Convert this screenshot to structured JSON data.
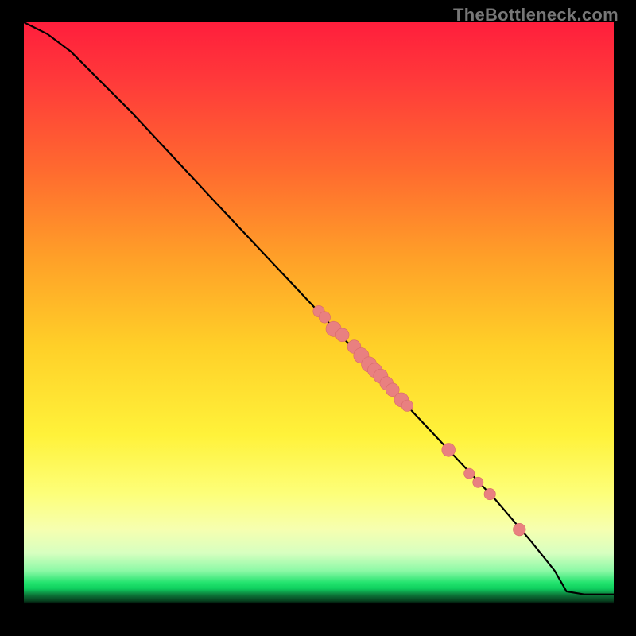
{
  "watermark": "TheBottleneck.com",
  "colors": {
    "curve": "#000000",
    "dot_fill": "#e98080",
    "dot_stroke": "#d86a6a"
  },
  "chart_data": {
    "type": "line",
    "title": "",
    "xlabel": "",
    "ylabel": "",
    "xlim": [
      0,
      100
    ],
    "ylim": [
      0,
      100
    ],
    "grid": false,
    "legend": false,
    "series": [
      {
        "name": "curve",
        "note": "Black curve. Starts at top-left (x≈0, y≈100), gentle shoulder then roughly linear descent to x≈92 where it flattens near y≈3 and runs flat to x=100.",
        "x": [
          0,
          4,
          8,
          12,
          18,
          25,
          32,
          40,
          48,
          56,
          64,
          72,
          80,
          86,
          90,
          92,
          95,
          100
        ],
        "y": [
          100,
          98,
          95,
          91,
          85,
          77.5,
          70,
          61.5,
          53,
          44.5,
          36,
          27.5,
          19,
          12,
          7,
          3.5,
          3,
          3
        ]
      }
    ],
    "points": [
      {
        "name": "cluster-a-1",
        "x": 50,
        "y": 51,
        "r": 1.2
      },
      {
        "name": "cluster-a-2",
        "x": 51,
        "y": 50,
        "r": 1.2
      },
      {
        "name": "cluster-a-3",
        "x": 52.5,
        "y": 48,
        "r": 1.6
      },
      {
        "name": "cluster-a-4",
        "x": 54,
        "y": 47,
        "r": 1.4
      },
      {
        "name": "cluster-b-1",
        "x": 56,
        "y": 45,
        "r": 1.4
      },
      {
        "name": "cluster-b-2",
        "x": 57.2,
        "y": 43.5,
        "r": 1.6
      },
      {
        "name": "cluster-b-3",
        "x": 58.5,
        "y": 42,
        "r": 1.6
      },
      {
        "name": "cluster-b-4",
        "x": 59.5,
        "y": 41,
        "r": 1.5
      },
      {
        "name": "cluster-b-5",
        "x": 60.5,
        "y": 40,
        "r": 1.5
      },
      {
        "name": "cluster-b-6",
        "x": 61.5,
        "y": 38.8,
        "r": 1.4
      },
      {
        "name": "cluster-b-7",
        "x": 62.5,
        "y": 37.7,
        "r": 1.4
      },
      {
        "name": "cluster-b-8",
        "x": 64,
        "y": 36,
        "r": 1.5
      },
      {
        "name": "cluster-b-9",
        "x": 65,
        "y": 35,
        "r": 1.2
      },
      {
        "name": "single-c-1",
        "x": 72,
        "y": 27.5,
        "r": 1.4
      },
      {
        "name": "single-c-2",
        "x": 75.5,
        "y": 23.5,
        "r": 1.1
      },
      {
        "name": "single-c-3",
        "x": 77,
        "y": 22,
        "r": 1.1
      },
      {
        "name": "single-c-4",
        "x": 79,
        "y": 20,
        "r": 1.2
      },
      {
        "name": "single-d-1",
        "x": 84,
        "y": 14,
        "r": 1.3
      }
    ]
  }
}
